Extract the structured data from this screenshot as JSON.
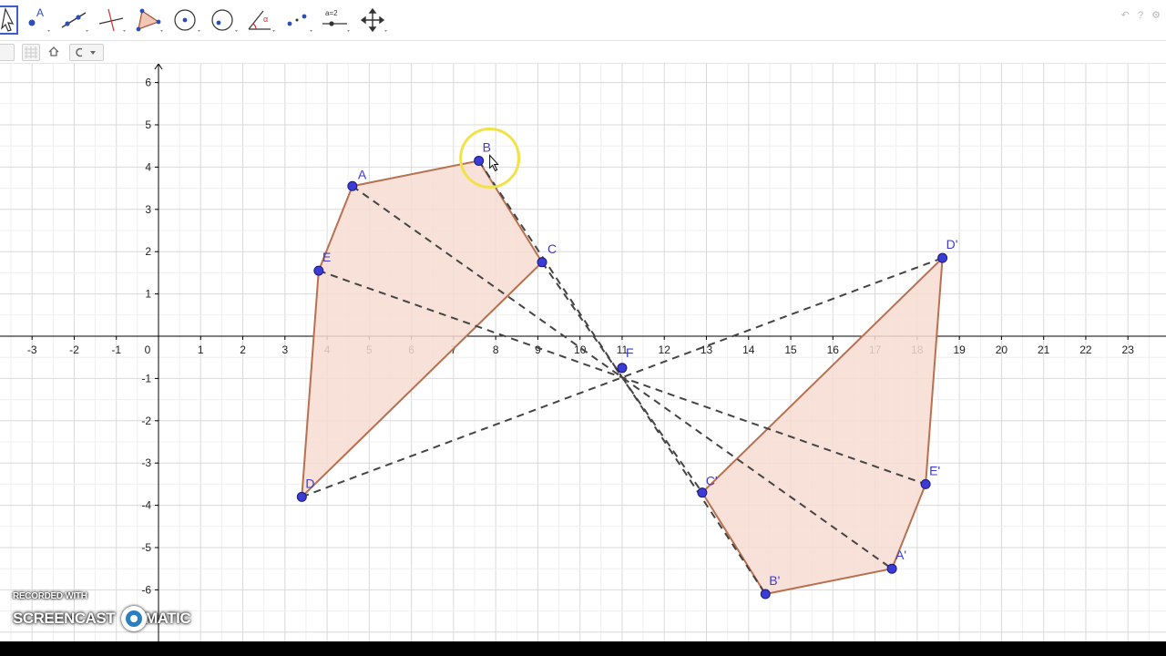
{
  "toolbar": {
    "tools": [
      {
        "name": "move-tool-icon",
        "selected": true
      },
      {
        "name": "point-tool-icon",
        "selected": false
      },
      {
        "name": "line-tool-icon",
        "selected": false
      },
      {
        "name": "perpendicular-line-tool-icon",
        "selected": false
      },
      {
        "name": "polygon-tool-icon",
        "selected": false
      },
      {
        "name": "circle-tool-icon",
        "selected": false
      },
      {
        "name": "circle-three-points-tool-icon",
        "selected": false
      },
      {
        "name": "angle-tool-icon",
        "selected": false
      },
      {
        "name": "reflect-tool-icon",
        "selected": false
      },
      {
        "name": "slider-tool-icon",
        "selected": false
      },
      {
        "name": "move-graphics-view-tool-icon",
        "selected": false
      }
    ],
    "slider_label": "a=2"
  },
  "stylebar": {
    "icons": [
      "axes-toggle-icon",
      "grid-toggle-icon",
      "home-icon",
      "undo-dropdown-icon"
    ]
  },
  "graph": {
    "x_ticks": [
      "-3",
      "-2",
      "-1",
      "0",
      "1",
      "2",
      "3",
      "4",
      "5",
      "6",
      "7",
      "8",
      "9",
      "10",
      "11",
      "12",
      "13",
      "14",
      "15",
      "16",
      "17",
      "18",
      "19",
      "20",
      "21",
      "22",
      "23"
    ],
    "y_ticks": [
      "6",
      "5",
      "4",
      "3",
      "2",
      "1",
      "-1",
      "-2",
      "-3",
      "-4",
      "-5",
      "-6"
    ],
    "points": [
      {
        "label": "A",
        "x": 4.6,
        "y": 3.55
      },
      {
        "label": "B",
        "x": 7.6,
        "y": 4.15
      },
      {
        "label": "C",
        "x": 9.1,
        "y": 1.75
      },
      {
        "label": "D",
        "x": 3.4,
        "y": -3.8
      },
      {
        "label": "E",
        "x": 3.8,
        "y": 1.55
      },
      {
        "label": "F",
        "x": 11.0,
        "y": -0.75
      },
      {
        "label": "A'",
        "x": 17.4,
        "y": -5.5
      },
      {
        "label": "B'",
        "x": 14.4,
        "y": -6.1
      },
      {
        "label": "C'",
        "x": 12.9,
        "y": -3.7
      },
      {
        "label": "D'",
        "x": 18.6,
        "y": 1.85
      },
      {
        "label": "E'",
        "x": 18.2,
        "y": -3.5
      }
    ],
    "polygon1": [
      "A",
      "B",
      "C",
      "D",
      "E"
    ],
    "polygon2": [
      "A'",
      "B'",
      "C'",
      "D'",
      "E'"
    ],
    "dashed_lines": [
      [
        "A",
        "A'"
      ],
      [
        "B",
        "B'"
      ],
      [
        "C",
        "C'"
      ],
      [
        "D",
        "D'"
      ],
      [
        "E",
        "E'"
      ]
    ],
    "colors": {
      "polygon_fill": "#f6dcd2",
      "polygon_edge": "#b8704f",
      "point": "#3b3bd6",
      "label": "#3b3bd6",
      "dashed": "#444444",
      "grid": "#e6e6e6",
      "axis": "#000000",
      "highlight": "#f2e24a"
    }
  },
  "watermark": {
    "line1": "RECORDED WITH",
    "line2a": "SCREENCAST",
    "line2b": "MATIC"
  }
}
